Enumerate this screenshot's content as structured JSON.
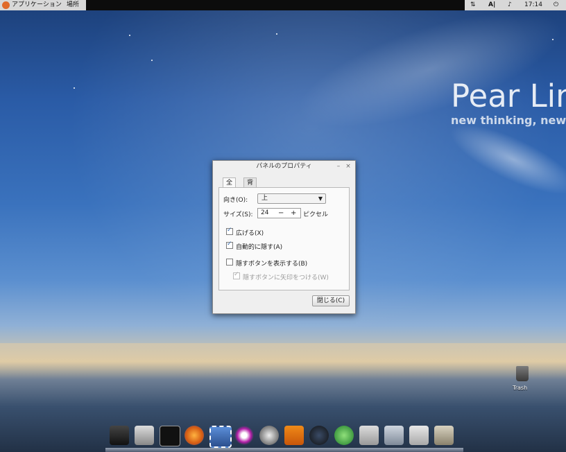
{
  "top_panel": {
    "applications_label": "アプリケーション",
    "places_label": "場所",
    "keyboard_indicator": "A|",
    "clock": "17:14"
  },
  "desktop": {
    "brand_title": "Pear Lin",
    "brand_subtitle": "new thinking, new p",
    "trash_label": "Trash"
  },
  "dialog": {
    "title": "パネルのプロパティ",
    "minimize": "–",
    "close_x": "×",
    "tabs": [
      "全般",
      "背景"
    ],
    "orientation_label": "向き(O):",
    "orientation_value": "上",
    "size_label": "サイズ(S):",
    "size_value": "24",
    "size_unit": "ピクセル",
    "spin_minus": "−",
    "spin_plus": "+",
    "expand_label": "広げる(X)",
    "autohide_label": "自動的に隠す(A)",
    "show_hide_buttons_label": "隠すボタンを表示する(B)",
    "arrows_on_hide_buttons_label": "隠すボタンに矢印をつける(W)",
    "close_button": "閉じる(C)"
  },
  "dock": {
    "icons": [
      "monitor-icon",
      "rocket-icon",
      "terminal-icon",
      "firefox-icon",
      "stamp-icon",
      "eye-icon",
      "disc-icon",
      "vlc-icon",
      "app-store-icon",
      "globe-icon",
      "camera-icon",
      "tools-icon",
      "drive-icon",
      "gimp-icon"
    ]
  },
  "colors": {
    "accent": "#3a6fb0",
    "panel": "#0c0c0c"
  }
}
